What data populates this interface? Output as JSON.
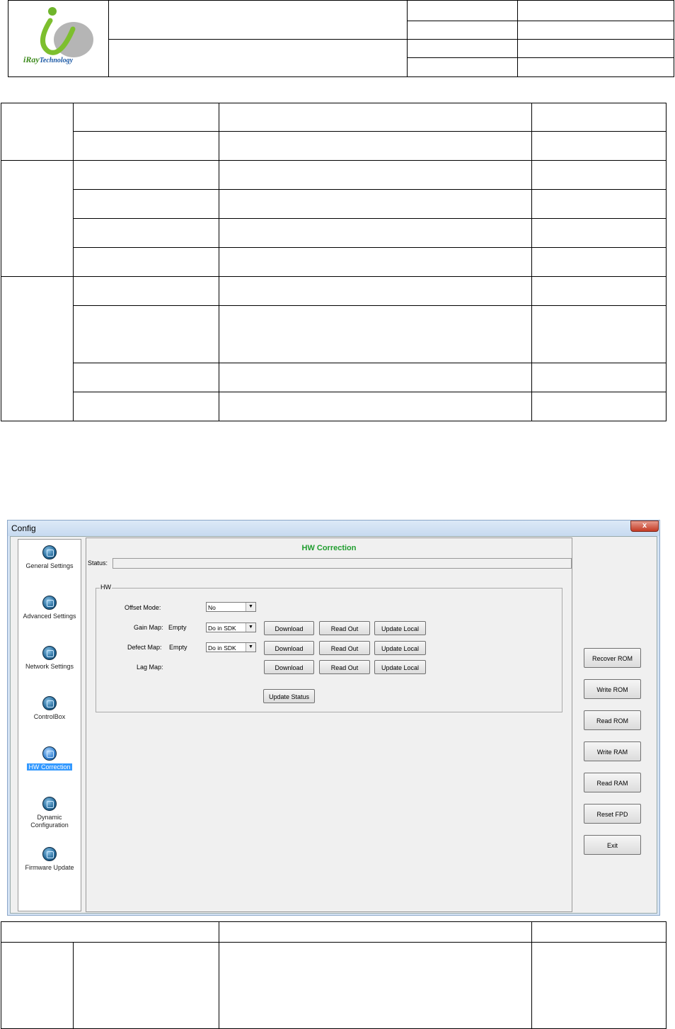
{
  "logo": {
    "mark": "i",
    "brand": "Ray",
    "word": "Technology"
  },
  "window": {
    "title": "Config",
    "close_symbol": "x",
    "nav": [
      {
        "label": "General Settings",
        "icon": "general-settings-icon"
      },
      {
        "label": "Advanced Settings",
        "icon": "advanced-settings-icon"
      },
      {
        "label": "Network Settings",
        "icon": "network-settings-icon"
      },
      {
        "label": "ControlBox",
        "icon": "controlbox-icon"
      },
      {
        "label": "HW Correction",
        "icon": "hw-correction-icon",
        "selected": true
      },
      {
        "label": "Dynamic Configuration",
        "icon": "dynamic-configuration-icon"
      },
      {
        "label": "Firmware Update",
        "icon": "firmware-update-icon"
      }
    ],
    "panel_title": "HW Correction",
    "status_label": "Status:",
    "status_value": "",
    "group_label": "HW",
    "rows": {
      "offset": {
        "label": "Offset Mode:",
        "combo": "No"
      },
      "gain": {
        "label": "Gain Map:",
        "state": "Empty",
        "combo": "Do in SDK"
      },
      "defect": {
        "label": "Defect Map:",
        "state": "Empty",
        "combo": "Do in SDK"
      },
      "lag": {
        "label": "Lag Map:"
      }
    },
    "row_buttons": {
      "download": "Download",
      "read_out": "Read Out",
      "update_local": "Update Local"
    },
    "update_status": "Update Status",
    "side_buttons": [
      "Recover ROM",
      "Write ROM",
      "Read ROM",
      "Write RAM",
      "Read RAM",
      "Reset FPD",
      "Exit"
    ]
  }
}
